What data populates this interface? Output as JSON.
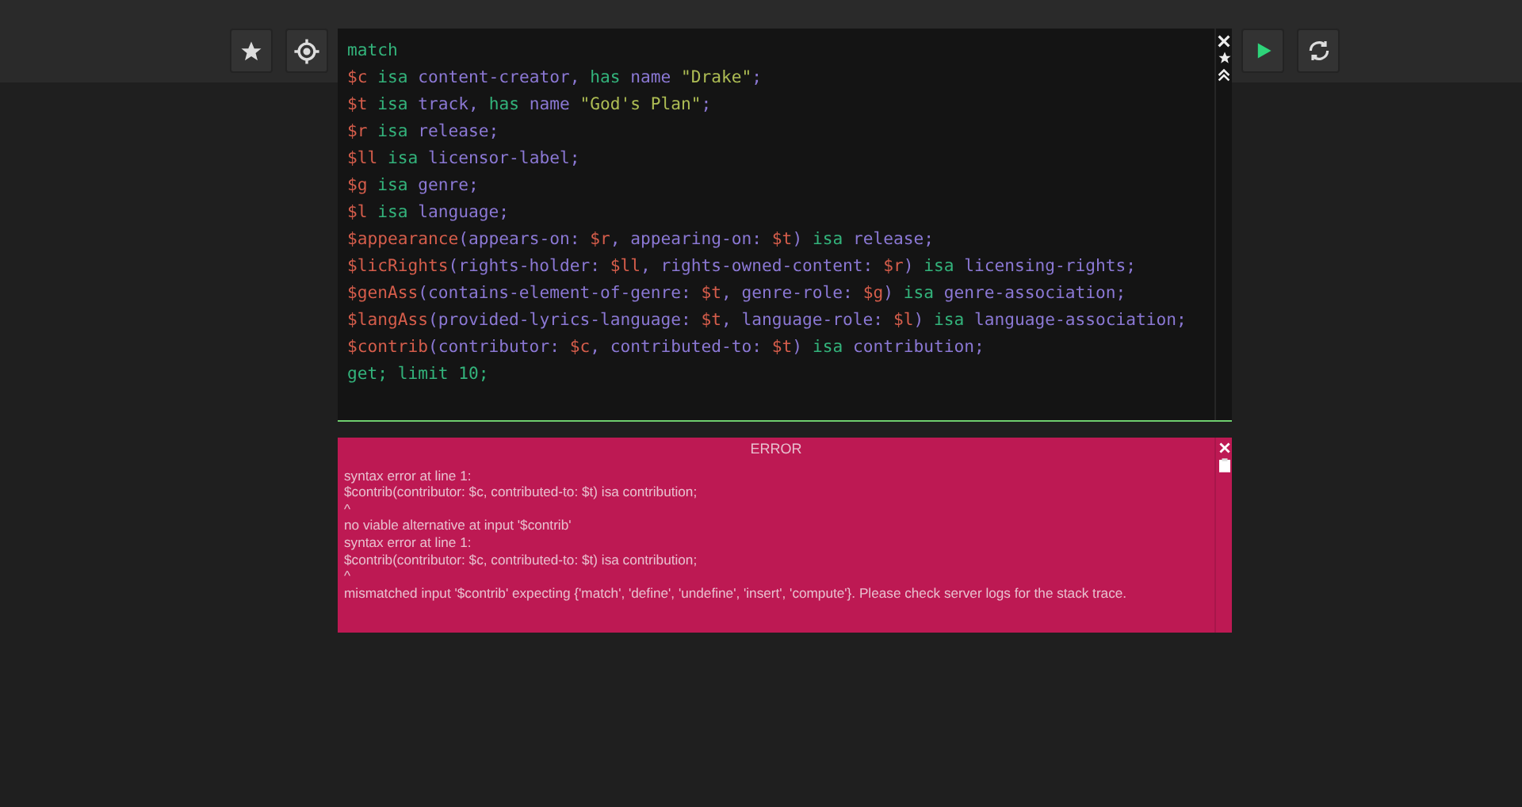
{
  "editor": {
    "lines": [
      [
        {
          "text": "match",
          "kind": "kw"
        }
      ],
      [
        {
          "text": "$c",
          "kind": "var"
        },
        {
          "text": " isa",
          "kind": "kw"
        },
        {
          "text": " content-creator, ",
          "kind": "type"
        },
        {
          "text": "has",
          "kind": "kw"
        },
        {
          "text": " name ",
          "kind": "type"
        },
        {
          "text": "\"Drake\"",
          "kind": "str"
        },
        {
          "text": ";",
          "kind": "type"
        }
      ],
      [
        {
          "text": "$t",
          "kind": "var"
        },
        {
          "text": " isa",
          "kind": "kw"
        },
        {
          "text": " track, ",
          "kind": "type"
        },
        {
          "text": "has",
          "kind": "kw"
        },
        {
          "text": " name ",
          "kind": "type"
        },
        {
          "text": "\"God's Plan\"",
          "kind": "str"
        },
        {
          "text": ";",
          "kind": "type"
        }
      ],
      [
        {
          "text": "$r",
          "kind": "var"
        },
        {
          "text": " isa",
          "kind": "kw"
        },
        {
          "text": " release;",
          "kind": "type"
        }
      ],
      [
        {
          "text": "$ll",
          "kind": "var"
        },
        {
          "text": " isa",
          "kind": "kw"
        },
        {
          "text": " licensor-label;",
          "kind": "type"
        }
      ],
      [
        {
          "text": "$g",
          "kind": "var"
        },
        {
          "text": " isa",
          "kind": "kw"
        },
        {
          "text": " genre;",
          "kind": "type"
        }
      ],
      [
        {
          "text": "$l",
          "kind": "var"
        },
        {
          "text": " isa",
          "kind": "kw"
        },
        {
          "text": " language;",
          "kind": "type"
        }
      ],
      [
        {
          "text": "$appearance",
          "kind": "var"
        },
        {
          "text": "(appears-on: ",
          "kind": "type"
        },
        {
          "text": "$r",
          "kind": "var"
        },
        {
          "text": ", appearing-on: ",
          "kind": "type"
        },
        {
          "text": "$t",
          "kind": "var"
        },
        {
          "text": ") ",
          "kind": "type"
        },
        {
          "text": "isa",
          "kind": "kw"
        },
        {
          "text": " release;",
          "kind": "type"
        }
      ],
      [
        {
          "text": "$licRights",
          "kind": "var"
        },
        {
          "text": "(rights-holder: ",
          "kind": "type"
        },
        {
          "text": "$ll",
          "kind": "var"
        },
        {
          "text": ", rights-owned-content: ",
          "kind": "type"
        },
        {
          "text": "$r",
          "kind": "var"
        },
        {
          "text": ") ",
          "kind": "type"
        },
        {
          "text": "isa",
          "kind": "kw"
        },
        {
          "text": " licensing-rights;",
          "kind": "type"
        }
      ],
      [
        {
          "text": "$genAss",
          "kind": "var"
        },
        {
          "text": "(contains-element-of-genre: ",
          "kind": "type"
        },
        {
          "text": "$t",
          "kind": "var"
        },
        {
          "text": ", genre-role: ",
          "kind": "type"
        },
        {
          "text": "$g",
          "kind": "var"
        },
        {
          "text": ") ",
          "kind": "type"
        },
        {
          "text": "isa",
          "kind": "kw"
        },
        {
          "text": " genre-association;",
          "kind": "type"
        }
      ],
      [
        {
          "text": "$langAss",
          "kind": "var"
        },
        {
          "text": "(provided-lyrics-language: ",
          "kind": "type"
        },
        {
          "text": "$t",
          "kind": "var"
        },
        {
          "text": ", language-role: ",
          "kind": "type"
        },
        {
          "text": "$l",
          "kind": "var"
        },
        {
          "text": ") ",
          "kind": "type"
        },
        {
          "text": "isa",
          "kind": "kw"
        },
        {
          "text": " language-association;",
          "kind": "type"
        }
      ],
      [
        {
          "text": "$contrib",
          "kind": "var"
        },
        {
          "text": "(contributor: ",
          "kind": "type"
        },
        {
          "text": "$c",
          "kind": "var"
        },
        {
          "text": ", contributed-to: ",
          "kind": "type"
        },
        {
          "text": "$t",
          "kind": "var"
        },
        {
          "text": ") ",
          "kind": "type"
        },
        {
          "text": "isa",
          "kind": "kw"
        },
        {
          "text": " contribution;",
          "kind": "type"
        }
      ],
      [
        {
          "text": "get; limit 10;",
          "kind": "kw"
        }
      ]
    ]
  },
  "error": {
    "title": "ERROR",
    "lines": [
      "syntax error at line 1:",
      "$contrib(contributor: $c, contributed-to: $t) isa contribution;",
      "^",
      "no viable alternative at input '$contrib'",
      "syntax error at line 1:",
      "$contrib(contributor: $c, contributed-to: $t) isa contribution;",
      "^",
      "mismatched input '$contrib' expecting {'match', 'define', 'undefine', 'insert', 'compute'}. Please check server logs for the stack trace."
    ]
  }
}
